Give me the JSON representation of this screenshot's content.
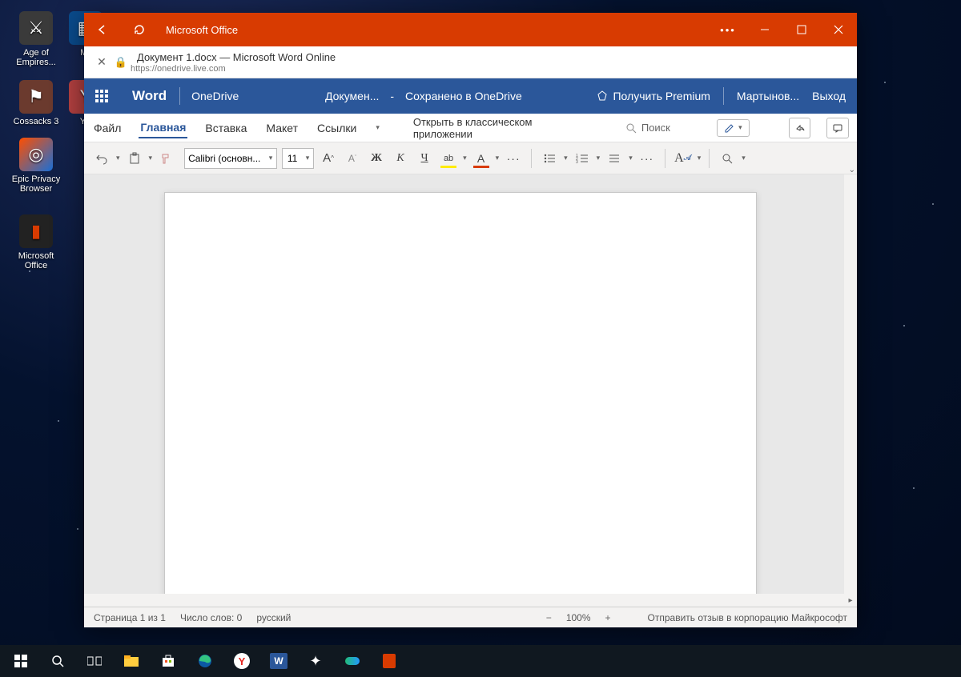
{
  "desktop_icons": [
    {
      "label": "Age of Empires...",
      "bg": "#3a3a3a"
    },
    {
      "label": "Mi",
      "bg": "#0a4b8c"
    },
    {
      "label": "Cossacks 3",
      "bg": "#6b3a2e"
    },
    {
      "label": "Yo",
      "bg": "#b34040"
    },
    {
      "label": "Epic Privacy Browser",
      "bg": "#1a6fd6"
    },
    {
      "label": "Microsoft Office",
      "bg": "#d83b01"
    }
  ],
  "titlebar": {
    "app": "Microsoft Office"
  },
  "address": {
    "title": "Документ 1.docx — Microsoft Word Online",
    "url": "https://onedrive.live.com"
  },
  "header": {
    "brand": "Word",
    "onedrive": "OneDrive",
    "docname": "Докумен...",
    "dash": "-",
    "saved": "Сохранено в OneDrive",
    "premium": "Получить Premium",
    "user": "Мартынов...",
    "exit": "Выход"
  },
  "tabs": {
    "file": "Файл",
    "home": "Главная",
    "insert": "Вставка",
    "layout": "Макет",
    "refs": "Ссылки",
    "open_in": "Открыть в классическом приложении",
    "search": "Поиск"
  },
  "toolbar": {
    "font_name": "Calibri (основн...",
    "font_size": "11",
    "A_inc": "A",
    "A_dec": "A",
    "bold": "Ж",
    "italic": "К",
    "underline": "Ч",
    "hl": "ab",
    "fontcolor": "A",
    "more": "···",
    "styles": "A",
    "find": "🔍"
  },
  "status": {
    "page": "Страница 1 из 1",
    "words": "Число слов: 0",
    "lang": "русский",
    "zoom": "100%",
    "feedback": "Отправить отзыв в корпорацию Майкрософт"
  }
}
